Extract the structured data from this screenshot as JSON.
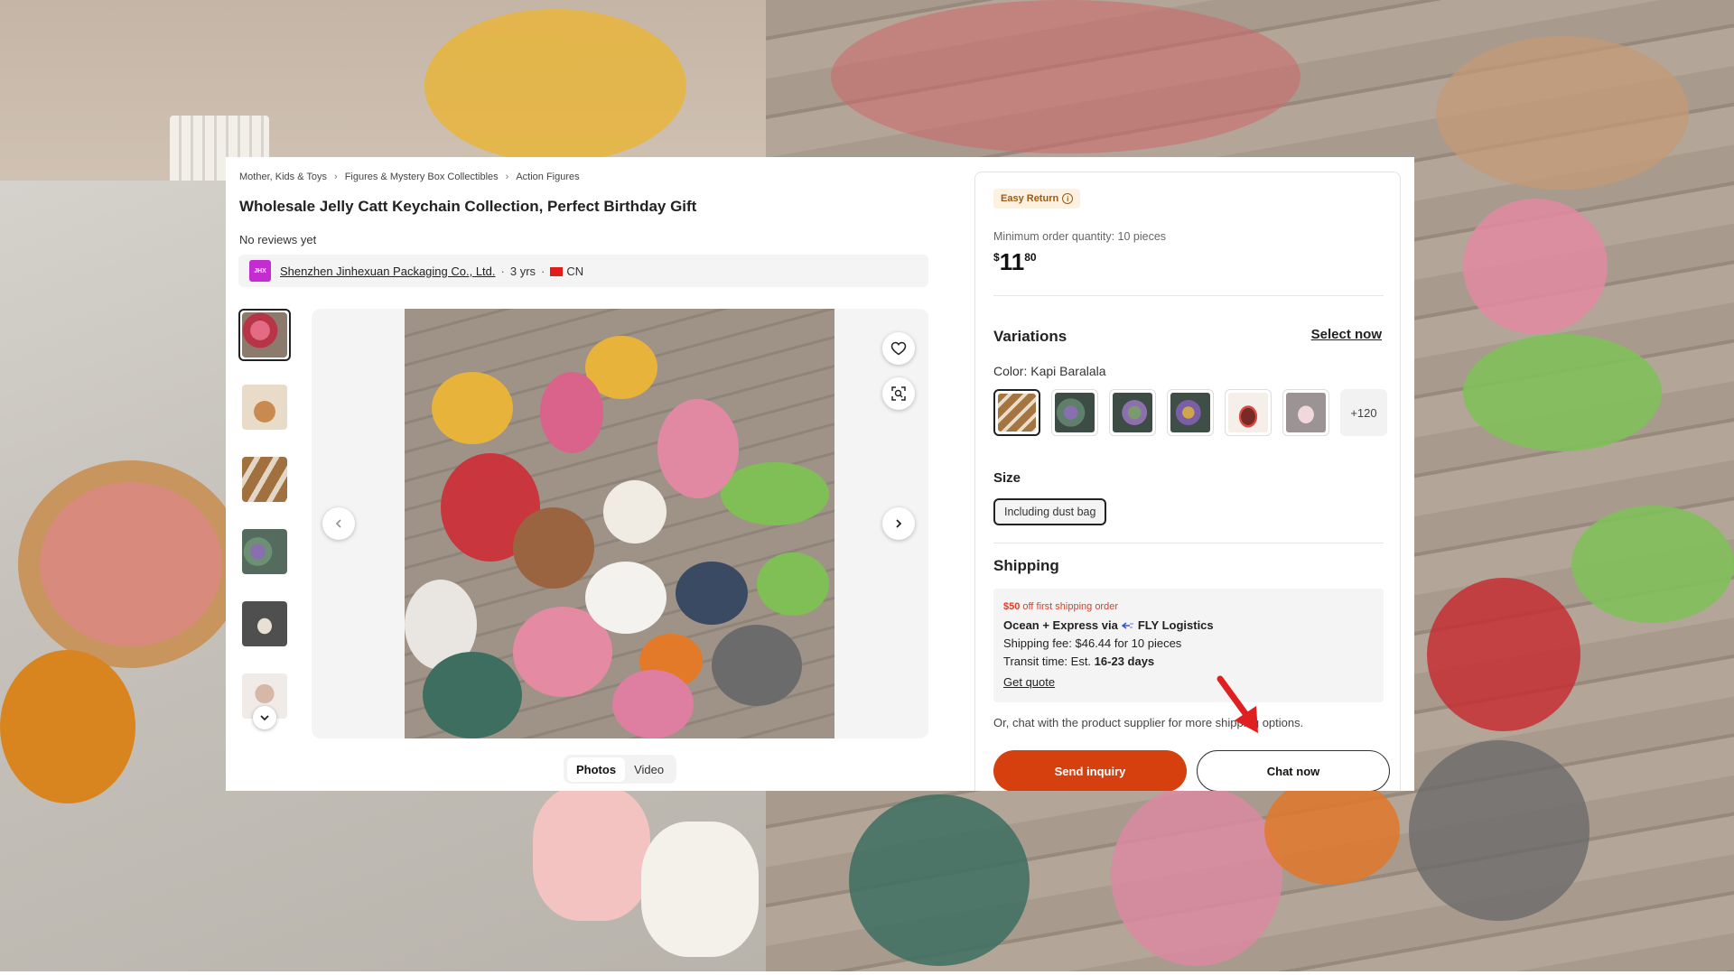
{
  "breadcrumb": {
    "items": [
      "Mother, Kids & Toys",
      "Figures & Mystery Box Collectibles",
      "Action Figures"
    ]
  },
  "product": {
    "title": "Wholesale Jelly Catt Keychain Collection, Perfect Birthday Gift",
    "reviews": "No reviews yet"
  },
  "supplier": {
    "name": "Shenzhen Jinhexuan Packaging Co., Ltd.",
    "years": "3 yrs",
    "country": "CN"
  },
  "media": {
    "tabs": [
      "Photos",
      "Video"
    ],
    "active_tab": "Photos"
  },
  "panel": {
    "easy_return": "Easy Return",
    "moq": "Minimum order quantity: 10 pieces",
    "price": {
      "currency": "$",
      "whole": "11",
      "cents": "80"
    },
    "variations_title": "Variations",
    "select_now": "Select now",
    "color_label": "Color:",
    "color_value": "Kapi Baralala",
    "more_colors": "+120",
    "size_title": "Size",
    "size_option": "Including dust bag",
    "shipping_title": "Shipping",
    "ship_promo_amount": "$50",
    "ship_promo_text": "off first shipping order",
    "ship_method_a": "Ocean + Express via",
    "ship_method_b": "FLY Logistics",
    "ship_fee": "Shipping fee: $46.44 for 10 pieces",
    "ship_transit_label": "Transit time: Est.",
    "ship_transit_value": "16-23 days",
    "get_quote": "Get quote",
    "chat_note": "Or, chat with the product supplier for more shipping options.",
    "send_inquiry": "Send inquiry",
    "chat_now": "Chat now"
  },
  "colors": {
    "accent": "#d6400f",
    "promo": "#d6402b",
    "easy_return_bg": "#fdf1e1",
    "annotation_arrow": "#e02020"
  }
}
